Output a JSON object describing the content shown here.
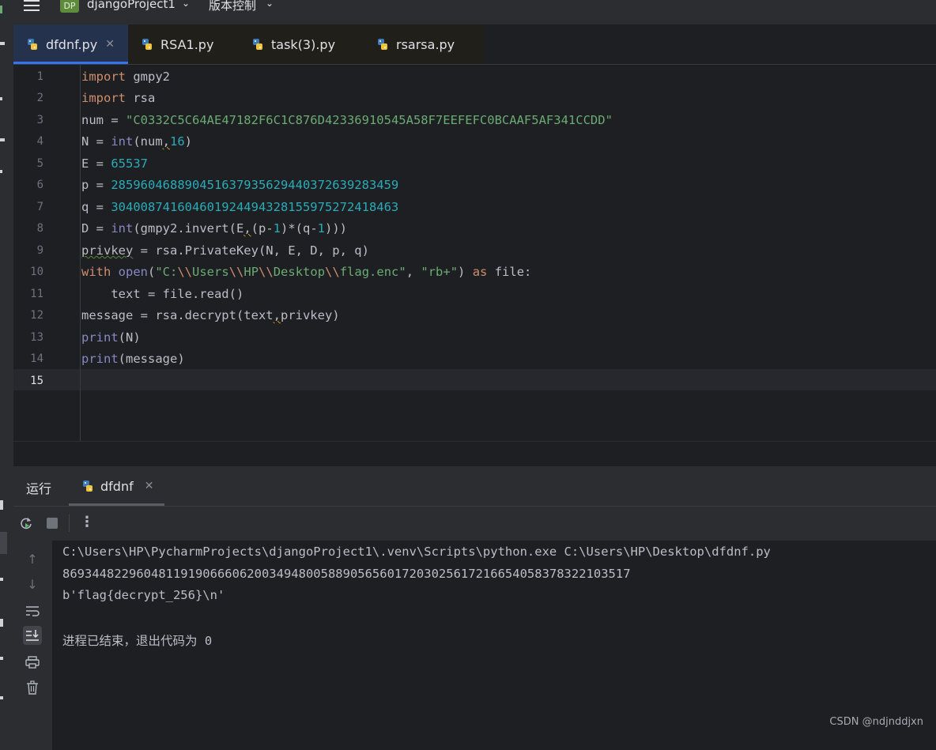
{
  "titlebar": {
    "project_badge": "DP",
    "project_name": "djangoProject1",
    "vcs_label": "版本控制"
  },
  "tabs": [
    {
      "label": "dfdnf.py",
      "active": true,
      "closable": true
    },
    {
      "label": "RSA1.py",
      "active": false
    },
    {
      "label": "task(3).py",
      "active": false
    },
    {
      "label": "rsarsa.py",
      "active": false
    }
  ],
  "editor": {
    "current_line": 15,
    "line_numbers": [
      "1",
      "2",
      "3",
      "4",
      "5",
      "6",
      "7",
      "8",
      "9",
      "10",
      "11",
      "12",
      "13",
      "14",
      "15"
    ],
    "lines": [
      "import gmpy2",
      "import rsa",
      "num = \"C0332C5C64AE47182F6C1C876D42336910545A58F7EEFEFC0BCAAF5AF341CCDD\"",
      "N = int(num,16)",
      "E = 65537",
      "p = 285960468890451637935629440372639283459",
      "q = 304008741604601924494328155975272418463",
      "D = int(gmpy2.invert(E,(p-1)*(q-1)))",
      "privkey = rsa.PrivateKey(N, E, D, p, q)",
      "with open(\"C:\\\\Users\\\\HP\\\\Desktop\\\\flag.enc\", \"rb+\") as file:",
      "    text = file.read()",
      "message = rsa.decrypt(text,privkey)",
      "print(N)",
      "print(message)",
      ""
    ]
  },
  "run_panel": {
    "title": "运行",
    "tab_label": "dfdnf",
    "output": [
      "C:\\Users\\HP\\PycharmProjects\\djangoProject1\\.venv\\Scripts\\python.exe C:\\Users\\HP\\Desktop\\dfdnf.py",
      "86934482296048119190666062003494800588905656017203025617216654058378322103517",
      "b'flag{decrypt_256}\\n'",
      "",
      "进程已结束，退出代码为 0"
    ]
  },
  "watermark": "CSDN @ndjnddjxn",
  "icons": [
    "menu-icon",
    "python-file-icon",
    "close-icon",
    "rerun-icon",
    "stop-icon",
    "more-icon",
    "scroll-up-icon",
    "scroll-down-icon",
    "soft-wrap-icon",
    "scroll-to-end-icon",
    "print-icon",
    "trash-icon"
  ],
  "colors": {
    "keyword": "#cf8e6d",
    "string": "#6aab73",
    "number": "#2aacb8",
    "builtin": "#8888c6",
    "accent": "#3574f0"
  }
}
